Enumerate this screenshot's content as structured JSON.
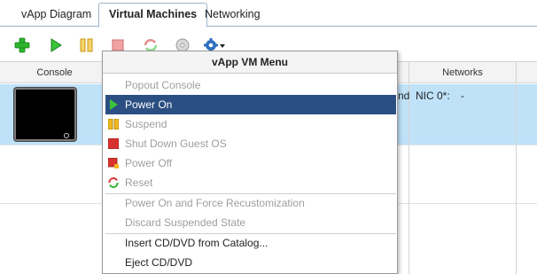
{
  "tabs": [
    {
      "label": "vApp Diagram",
      "active": false
    },
    {
      "label": "Virtual Machines",
      "active": true
    },
    {
      "label": "Networking",
      "active": false
    }
  ],
  "toolbar": {
    "icons": [
      "add-vm-icon",
      "power-on-icon",
      "suspend-icon",
      "shut-down-icon",
      "reset-icon",
      "insert-media-icon",
      "actions-gear-icon"
    ]
  },
  "grid": {
    "columns": {
      "console": "Console",
      "networks": "Networks"
    },
    "row": {
      "trailing_text": "nd",
      "nic": "NIC 0*:",
      "nic_value": "-"
    }
  },
  "menu": {
    "title": "vApp VM Menu",
    "items": [
      {
        "label": "Popout Console",
        "enabled": false,
        "icon": ""
      },
      {
        "label": "Power On",
        "enabled": true,
        "highlighted": true,
        "icon": "power-on-icon"
      },
      {
        "label": "Suspend",
        "enabled": false,
        "icon": "suspend-icon"
      },
      {
        "label": "Shut Down Guest OS",
        "enabled": false,
        "icon": "shut-down-icon"
      },
      {
        "label": "Power Off",
        "enabled": false,
        "icon": "power-off-icon"
      },
      {
        "label": "Reset",
        "enabled": false,
        "icon": "reset-icon"
      },
      {
        "label": "Power On and Force Recustomization",
        "enabled": false,
        "icon": ""
      },
      {
        "label": "Discard Suspended State",
        "enabled": false,
        "icon": ""
      },
      {
        "label": "Insert CD/DVD from Catalog...",
        "enabled": true,
        "icon": ""
      },
      {
        "label": "Eject CD/DVD",
        "enabled": true,
        "icon": ""
      }
    ]
  },
  "colors": {
    "highlight": "#2b4f82",
    "selected_row": "#bfe2f9",
    "green": "#2db52d",
    "red": "#d8322f",
    "yellow": "#f1b820",
    "gear_blue": "#2f6fbf"
  }
}
